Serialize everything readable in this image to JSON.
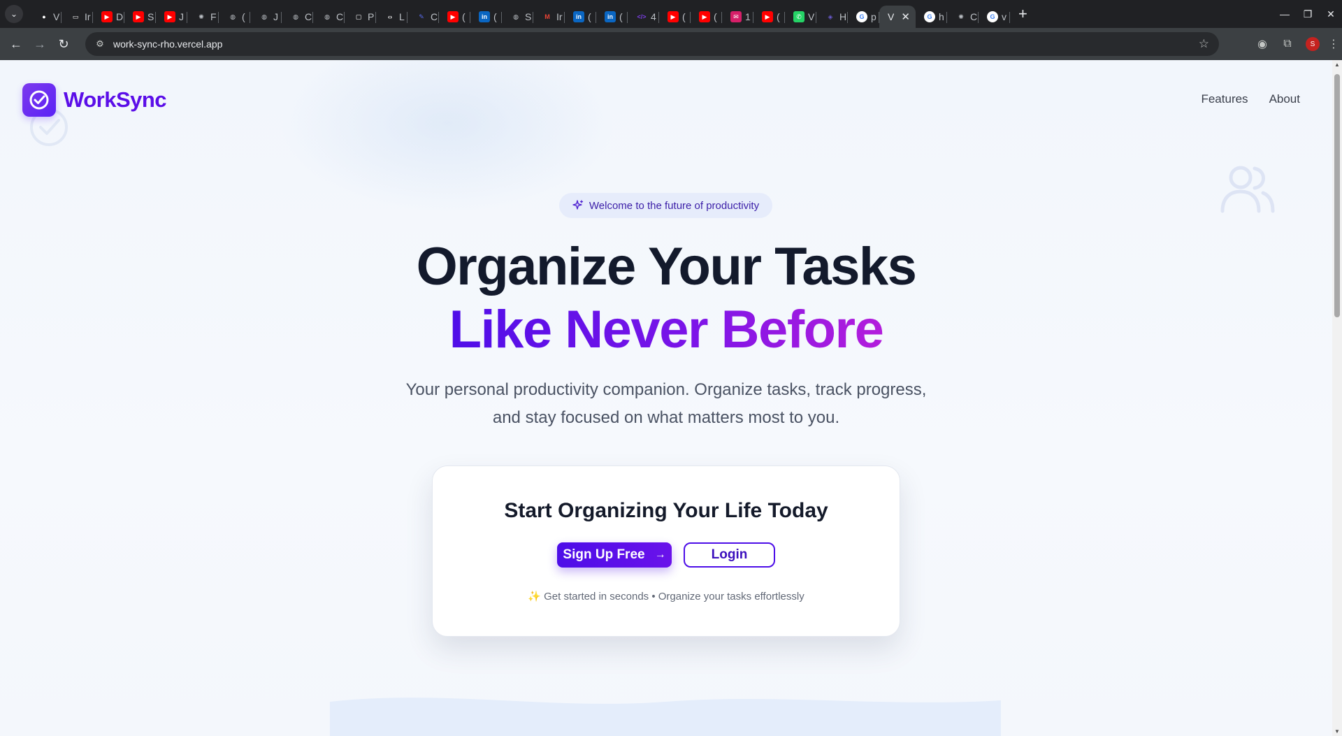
{
  "browser": {
    "tabs": [
      {
        "label": "V",
        "icon": "github-icon",
        "color": "#ffffff"
      },
      {
        "label": "Ir",
        "icon": "doc-icon",
        "color": "#ffffff"
      },
      {
        "label": "D",
        "icon": "youtube-icon",
        "color": "#ff0000"
      },
      {
        "label": "S",
        "icon": "youtube-icon",
        "color": "#ff0000"
      },
      {
        "label": "J",
        "icon": "youtube-icon",
        "color": "#ff0000"
      },
      {
        "label": "F",
        "icon": "openai-icon",
        "color": "#bdc1c6"
      },
      {
        "label": "(",
        "icon": "globe-icon",
        "color": "#bdc1c6"
      },
      {
        "label": "J",
        "icon": "globe-icon",
        "color": "#bdc1c6"
      },
      {
        "label": "C",
        "icon": "globe-icon",
        "color": "#bdc1c6"
      },
      {
        "label": "C",
        "icon": "globe-icon",
        "color": "#bdc1c6"
      },
      {
        "label": "P",
        "icon": "square-icon",
        "color": "#ffffff"
      },
      {
        "label": "L",
        "icon": "code-icon",
        "color": "#ffffff"
      },
      {
        "label": "C",
        "icon": "feather-icon",
        "color": "#5b6df0"
      },
      {
        "label": "(",
        "icon": "youtube-icon",
        "color": "#ff0000"
      },
      {
        "label": "(",
        "icon": "linkedin-icon",
        "color": "#0a66c2"
      },
      {
        "label": "S",
        "icon": "globe-icon",
        "color": "#bdc1c6"
      },
      {
        "label": "Ir",
        "icon": "gmail-icon",
        "color": "#ea4335"
      },
      {
        "label": "(",
        "icon": "linkedin-icon",
        "color": "#0a66c2"
      },
      {
        "label": "(",
        "icon": "linkedin-icon",
        "color": "#0a66c2"
      },
      {
        "label": "4",
        "icon": "code-tag-icon",
        "color": "#7b3fe4"
      },
      {
        "label": "(",
        "icon": "youtube-icon",
        "color": "#ff0000"
      },
      {
        "label": "(",
        "icon": "youtube-icon",
        "color": "#ff0000"
      },
      {
        "label": "1",
        "icon": "mail-icon",
        "color": "#d61f69"
      },
      {
        "label": "(",
        "icon": "youtube-icon",
        "color": "#ff0000"
      },
      {
        "label": "V",
        "icon": "whatsapp-icon",
        "color": "#25d366"
      },
      {
        "label": "H",
        "icon": "app-icon",
        "color": "#6a5acd"
      },
      {
        "label": "p",
        "icon": "google-icon",
        "color": "#4285f4"
      },
      {
        "label": "V",
        "icon": "",
        "color": "#e8eaed",
        "active": true
      },
      {
        "label": "h",
        "icon": "google-icon",
        "color": "#4285f4"
      },
      {
        "label": "C",
        "icon": "openai-icon",
        "color": "#bdc1c6"
      },
      {
        "label": "v",
        "icon": "google-icon",
        "color": "#4285f4"
      }
    ],
    "url": "work-sync-rho.vercel.app",
    "profile_initial": "S"
  },
  "page": {
    "brand": "WorkSync",
    "nav": {
      "features": "Features",
      "about": "About"
    },
    "badge": "Welcome to the future of productivity",
    "headline_1": "Organize Your Tasks",
    "headline_2": "Like Never Before",
    "subtitle_line_1": "Your personal productivity companion. Organize tasks, track progress,",
    "subtitle_line_2": "and stay focused on what matters most to you.",
    "card": {
      "title": "Start Organizing Your Life Today",
      "signup": "Sign Up Free",
      "login": "Login",
      "note": "✨ Get started in seconds • Organize your tasks effortlessly"
    },
    "colors": {
      "brand": "#5b0ee8",
      "accent_end": "#b31ddc",
      "heading": "#131a2c"
    }
  }
}
